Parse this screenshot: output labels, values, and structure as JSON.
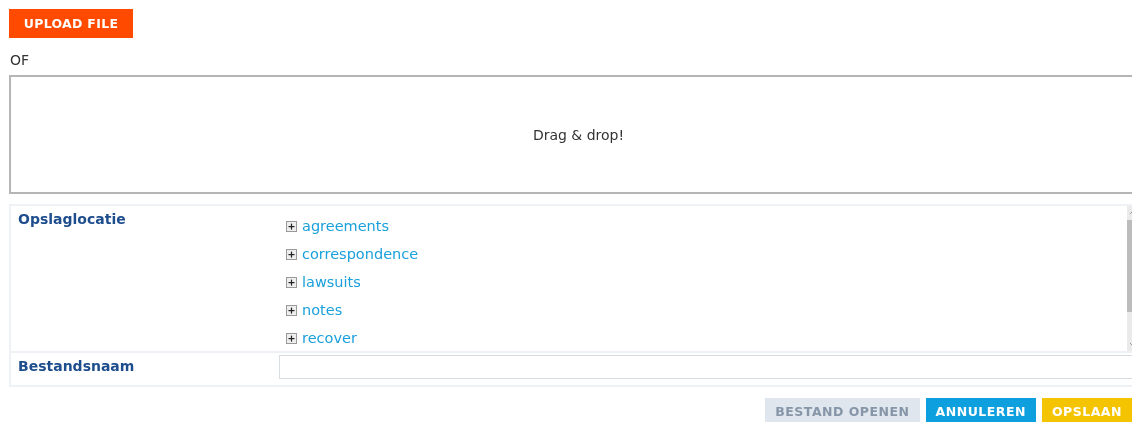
{
  "upload_button": "UPLOAD FILE",
  "separator": "OF",
  "drop_zone": {
    "text": "Drag & drop!"
  },
  "storage": {
    "label": "Opslaglocatie",
    "tree": [
      {
        "label": "agreements",
        "expanded": false
      },
      {
        "label": "correspondence",
        "expanded": false
      },
      {
        "label": "lawsuits",
        "expanded": false
      },
      {
        "label": "notes",
        "expanded": false
      },
      {
        "label": "recover",
        "expanded": false
      }
    ]
  },
  "filename": {
    "label": "Bestandsnaam"
  },
  "buttons": [
    {
      "label": "BESTAND OPENEN",
      "kind": "neutral",
      "disabled": true
    },
    {
      "label": "ANNULEREN",
      "kind": "cancel",
      "disabled": false
    },
    {
      "label": "OPSLAAN",
      "kind": "save",
      "disabled": false
    }
  ]
}
